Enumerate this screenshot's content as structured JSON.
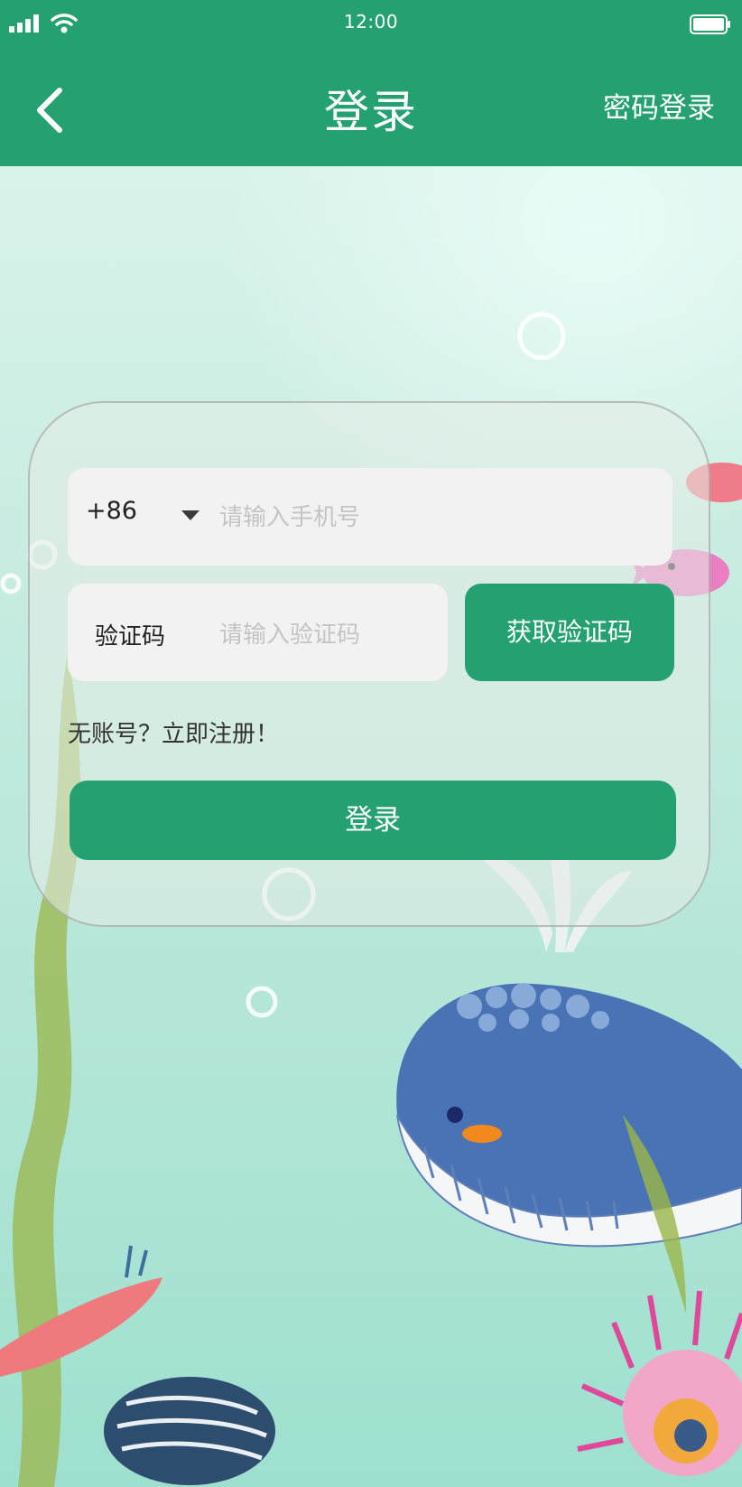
{
  "status_bar": {
    "time": "12:00"
  },
  "nav": {
    "title": "登录",
    "password_login_label": "密码登录"
  },
  "form": {
    "country_code": "+86",
    "phone_placeholder": "请输入手机号",
    "code_label": "验证码",
    "code_placeholder": "请输入验证码",
    "get_code_label": "获取验证码",
    "register_label": "无账号？立即注册！",
    "login_label": "登录"
  },
  "colors": {
    "brand_green": "#25a071",
    "field_bg": "#f2f2f2",
    "placeholder": "#c4c4c4"
  },
  "icons": {
    "back": "chevron-left-icon",
    "signal": "signal-icon",
    "wifi": "wifi-icon",
    "battery": "battery-icon",
    "dropdown": "caret-down-icon"
  }
}
